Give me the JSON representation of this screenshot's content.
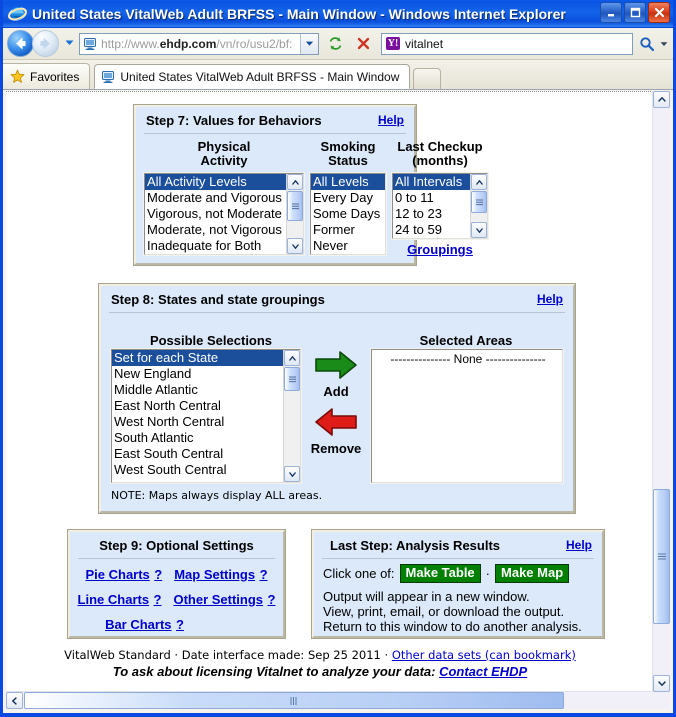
{
  "window": {
    "title": "United States VitalWeb Adult BRFSS - Main Window - Windows Internet Explorer",
    "minimize_label": "Minimize",
    "maximize_label": "Maximize",
    "close_label": "Close"
  },
  "toolbar": {
    "back_label": "Back",
    "forward_label": "Forward",
    "recent_pages_label": "Recent Pages",
    "url_prefix": "http://www.",
    "url_domain": "ehdp.com",
    "url_path": "/vn/ro/usu2/bf:",
    "url_full": "http://www.ehdp.com/vn/ro/usu2/bf:",
    "refresh_label": "Refresh",
    "stop_label": "Stop",
    "search_value": "vitalnet",
    "search_provider": "Y!",
    "search_go_label": "Search"
  },
  "tabs": {
    "favorites_label": "Favorites",
    "items": [
      {
        "label": "United States VitalWeb Adult BRFSS - Main Window",
        "active": true
      }
    ],
    "new_tab_label": "New Tab"
  },
  "step7": {
    "title": "Step 7: Values for Behaviors",
    "help_label": "Help",
    "columns": [
      {
        "header_line1": "Physical",
        "header_line2": "Activity",
        "items": [
          "All Activity Levels",
          "Moderate and Vigorous",
          "Vigorous, not Moderate",
          "Moderate, not Vigorous",
          "Inadequate for Both"
        ],
        "selected_index": 0
      },
      {
        "header_line1": "Smoking",
        "header_line2": "Status",
        "items": [
          "All Levels",
          "Every Day",
          "Some Days",
          "Former",
          "Never"
        ],
        "selected_index": 0
      },
      {
        "header_line1": "Last Checkup",
        "header_line2": "(months)",
        "items": [
          "All Intervals",
          "0 to 11",
          "12 to 23",
          "24 to 59"
        ],
        "selected_index": 0,
        "link_label": "Groupings"
      }
    ]
  },
  "step8": {
    "title": "Step 8: States and state groupings",
    "help_label": "Help",
    "possible_label": "Possible Selections",
    "selected_label": "Selected Areas",
    "possible_items": [
      "Set for each State",
      "New England",
      "Middle Atlantic",
      "East North Central",
      "West North Central",
      "South Atlantic",
      "East South Central",
      "West South Central"
    ],
    "possible_selected_index": 0,
    "selected_items": [
      "--------------- None ---------------"
    ],
    "add_label": "Add",
    "remove_label": "Remove",
    "note": "NOTE: Maps always display ALL areas."
  },
  "step9": {
    "title": "Step 9: Optional Settings",
    "links": [
      {
        "label": "Pie Charts",
        "help": "?"
      },
      {
        "label": "Map Settings",
        "help": "?"
      },
      {
        "label": "Line Charts",
        "help": "?"
      },
      {
        "label": "Other Settings",
        "help": "?"
      },
      {
        "label": "Bar Charts",
        "help": "?"
      }
    ]
  },
  "laststep": {
    "title": "Last Step: Analysis Results",
    "help_label": "Help",
    "click_one_of": "Click one of:",
    "make_table_label": "Make Table",
    "separator": "·",
    "make_map_label": "Make Map",
    "line1": "Output will appear in a new window.",
    "line2": "View, print, email, or download the output.",
    "line3": "Return to this window to do another analysis."
  },
  "footer": {
    "line1_a": "VitalWeb Standard · Date interface made: Sep 25 2011 · ",
    "line1_link": "Other data sets (can bookmark)",
    "line2_a": "To ask about licensing Vitalnet to analyze your data: ",
    "line2_link": "Contact EHDP"
  },
  "colors": {
    "panel_bg": "#dce9fa",
    "link": "#0000cc",
    "select_blue": "#1b4f9c",
    "green_button": "#008000",
    "add_arrow": "#1a7a18",
    "remove_arrow": "#d91e18",
    "titlebar": "#0a54e2"
  }
}
